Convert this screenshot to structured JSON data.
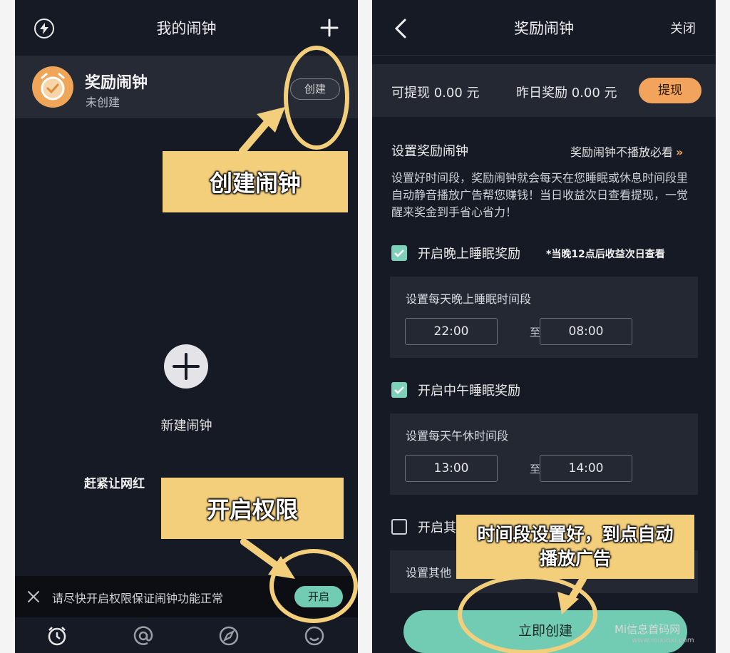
{
  "left_screen": {
    "header": {
      "title": "我的闹钟"
    },
    "alarm_card": {
      "name": "奖励闹钟",
      "status": "未创建",
      "create_label": "创建"
    },
    "new_alarm": {
      "label": "新建闹钟"
    },
    "promo_text": "赶紧让网红",
    "permission_bar": {
      "text": "请尽快开启权限保证闹钟功能正常",
      "button_label": "开启"
    },
    "tabs": [
      "alarm-clock-icon",
      "at-icon",
      "compass-icon",
      "smile-icon"
    ]
  },
  "right_screen": {
    "header": {
      "title": "奖励闹钟",
      "close_label": "关闭"
    },
    "balance": {
      "withdrawable": "可提现 0.00 元",
      "yesterday": "昨日奖励 0.00 元",
      "withdraw_label": "提现"
    },
    "section": {
      "title": "设置奖励闹钟",
      "must_read": "奖励闹钟不播放必看",
      "must_read_chevron": "»",
      "description": "设置好时间段，奖励闹钟就会每天在您睡眠或休息时间段里自动静音播放广告帮您赚钱！当日收益次日查看提现，一觉醒来奖金到手省心省力！"
    },
    "night": {
      "label": "开启晚上睡眠奖励",
      "checked": true,
      "note": "*当晚12点后收益次日查看",
      "panel_title": "设置每天晚上睡眠时间段",
      "start": "22:00",
      "to": "至",
      "end": "08:00"
    },
    "noon": {
      "label": "开启中午睡眠奖励",
      "checked": true,
      "panel_title": "设置每天午休时间段",
      "start": "13:00",
      "to": "至",
      "end": "14:00"
    },
    "other": {
      "label": "开启其",
      "checked": false,
      "panel_title": "设置其他"
    },
    "create_now_label": "立即创建"
  },
  "annotations": {
    "create_alarm": "创建闹钟",
    "enable_permission": "开启权限",
    "auto_play": "时间段设置好，到点自动播放广告"
  },
  "watermark": {
    "name": "Mi信息首码网",
    "url": "www.mixinxi.com"
  },
  "colors": {
    "accent_green": "#72cbb3",
    "accent_orange": "#f2a35c",
    "callout_yellow": "#f3cf7c",
    "screen_bg": "#161a24"
  }
}
